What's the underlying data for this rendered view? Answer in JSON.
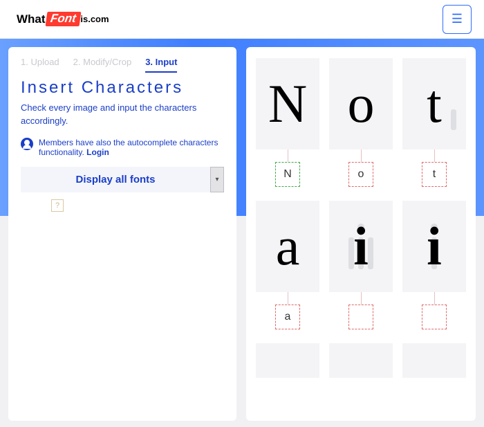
{
  "header": {
    "logo_what": "What",
    "logo_font": "Font",
    "logo_iscom": "is.com"
  },
  "steps": {
    "s1": "1. Upload",
    "s2": "2. Modify/Crop",
    "s3": "3. Input"
  },
  "title": "Insert Characters",
  "subtitle": "Check every image and input the characters accordingly.",
  "member_note": "Members have also the autocomplete characters functionality. ",
  "login_label": "Login",
  "display_fonts_label": "Display all fonts",
  "help_glyph": "?",
  "glyphs": {
    "r1": [
      "N",
      "o",
      "t"
    ],
    "r2": [
      "a",
      "",
      ""
    ]
  },
  "inputs": {
    "r1": [
      "N",
      "o",
      "t"
    ],
    "r2": [
      "a",
      "",
      ""
    ]
  },
  "big_i": "i"
}
